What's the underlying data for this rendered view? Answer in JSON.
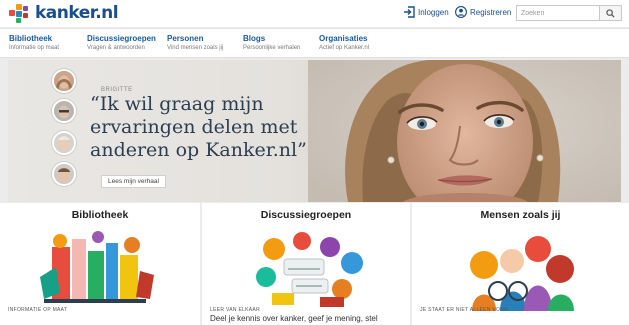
{
  "header": {
    "logo_text": "kanker.nl",
    "login_label": "Inloggen",
    "register_label": "Registreren",
    "search_placeholder": "Zoeken",
    "icons": {
      "login": "login-icon",
      "register": "user-icon",
      "search": "search-icon"
    }
  },
  "nav": {
    "items": [
      {
        "title": "Bibliotheek",
        "subtitle": "Informatie op maat"
      },
      {
        "title": "Discussiegroepen",
        "subtitle": "Vragen & antwoorden"
      },
      {
        "title": "Personen",
        "subtitle": "Vind mensen zoals jij"
      },
      {
        "title": "Blogs",
        "subtitle": "Persoonlijke verhalen"
      },
      {
        "title": "Organisaties",
        "subtitle": "Actief op Kanker.nl"
      }
    ]
  },
  "hero": {
    "speaker": "BRIGITTE",
    "quote": "“Ik wil graag mijn ervaringen delen met anderen op Kanker.nl”",
    "button_label": "Lees mijn verhaal"
  },
  "cards": [
    {
      "title": "Bibliotheek",
      "label": "INFORMATIE OP MAAT",
      "text": ""
    },
    {
      "title": "Discussiegroepen",
      "label": "LEER VAN ELKAAR",
      "text": "Deel je kennis over kanker, geef je mening, stel"
    },
    {
      "title": "Mensen zoals jij",
      "label": "JE STAAT ER NIET ALLEEN VOOR",
      "text": ""
    }
  ],
  "colors": {
    "brand_blue": "#1a4f8e",
    "nav_link": "#1a5aa0",
    "page_bg": "#ececec",
    "logo_dots": [
      "#e84c3d",
      "#f39c12",
      "#2e86c1",
      "#8e44ad",
      "#27ae60"
    ]
  }
}
